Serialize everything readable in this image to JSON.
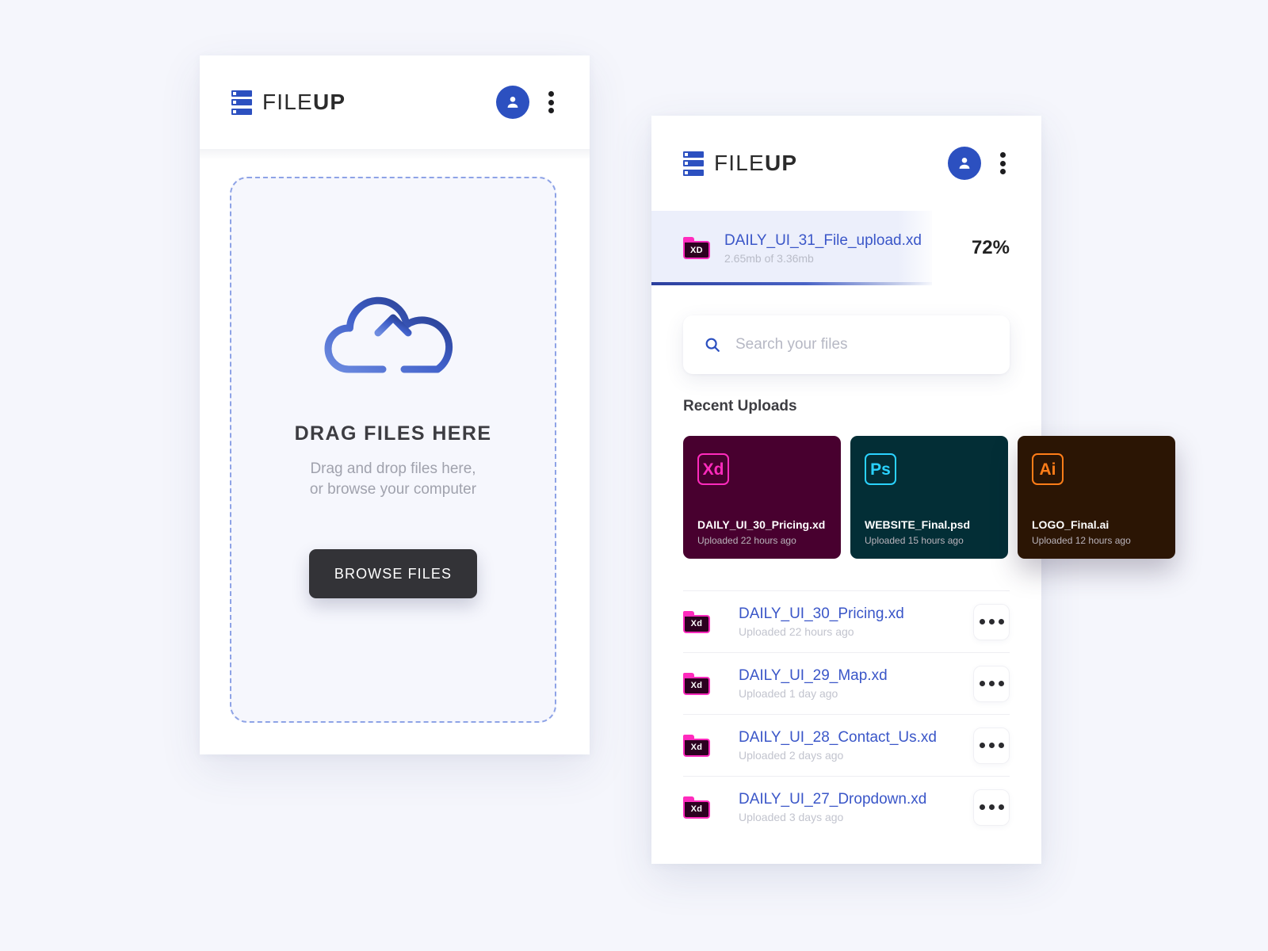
{
  "brand": {
    "name_light": "FILE",
    "name_bold": "UP",
    "logo_icon": "server-stack-icon"
  },
  "upload_panel": {
    "dropzone": {
      "icon": "cloud-upload-icon",
      "title": "DRAG FILES HERE",
      "subtitle_line1": "Drag and drop files here,",
      "subtitle_line2": "or browse your computer",
      "browse_label": "BROWSE FILES"
    }
  },
  "files_panel": {
    "active_upload": {
      "icon_label": "XD",
      "file_name": "DAILY_UI_31_File_upload.xd",
      "size_text": "2.65mb of 3.36mb",
      "percent_text": "72%",
      "percent_value": 72
    },
    "search": {
      "placeholder": "Search your files",
      "value": "",
      "icon": "search-icon"
    },
    "recent_uploads_title": "Recent Uploads",
    "recent_cards": [
      {
        "badge": "Xd",
        "type": "xd",
        "name": "DAILY_UI_30_Pricing.xd",
        "uploaded": "Uploaded 22 hours ago",
        "bg": "#48002f",
        "accent": "#ff2bbd"
      },
      {
        "badge": "Ps",
        "type": "ps",
        "name": "WEBSITE_Final.psd",
        "uploaded": "Uploaded 15 hours ago",
        "bg": "#032e36",
        "accent": "#2ad2ff"
      },
      {
        "badge": "Ai",
        "type": "ai",
        "name": "LOGO_Final.ai",
        "uploaded": "Uploaded 12 hours ago",
        "bg": "#2b1504",
        "accent": "#ff7d18"
      }
    ],
    "file_rows": [
      {
        "icon_label": "Xd",
        "name": "DAILY_UI_30_Pricing.xd",
        "uploaded": "Uploaded 22 hours ago"
      },
      {
        "icon_label": "Xd",
        "name": "DAILY_UI_29_Map.xd",
        "uploaded": "Uploaded 1 day ago"
      },
      {
        "icon_label": "Xd",
        "name": "DAILY_UI_28_Contact_Us.xd",
        "uploaded": "Uploaded 2 days ago"
      },
      {
        "icon_label": "Xd",
        "name": "DAILY_UI_27_Dropdown.xd",
        "uploaded": "Uploaded 3 days ago"
      }
    ]
  },
  "colors": {
    "brand_blue": "#2c50c0",
    "link_blue": "#3a56c8",
    "page_bg": "#f5f6fc",
    "dropzone_border": "#8ea3e6",
    "button_dark": "#333337"
  }
}
